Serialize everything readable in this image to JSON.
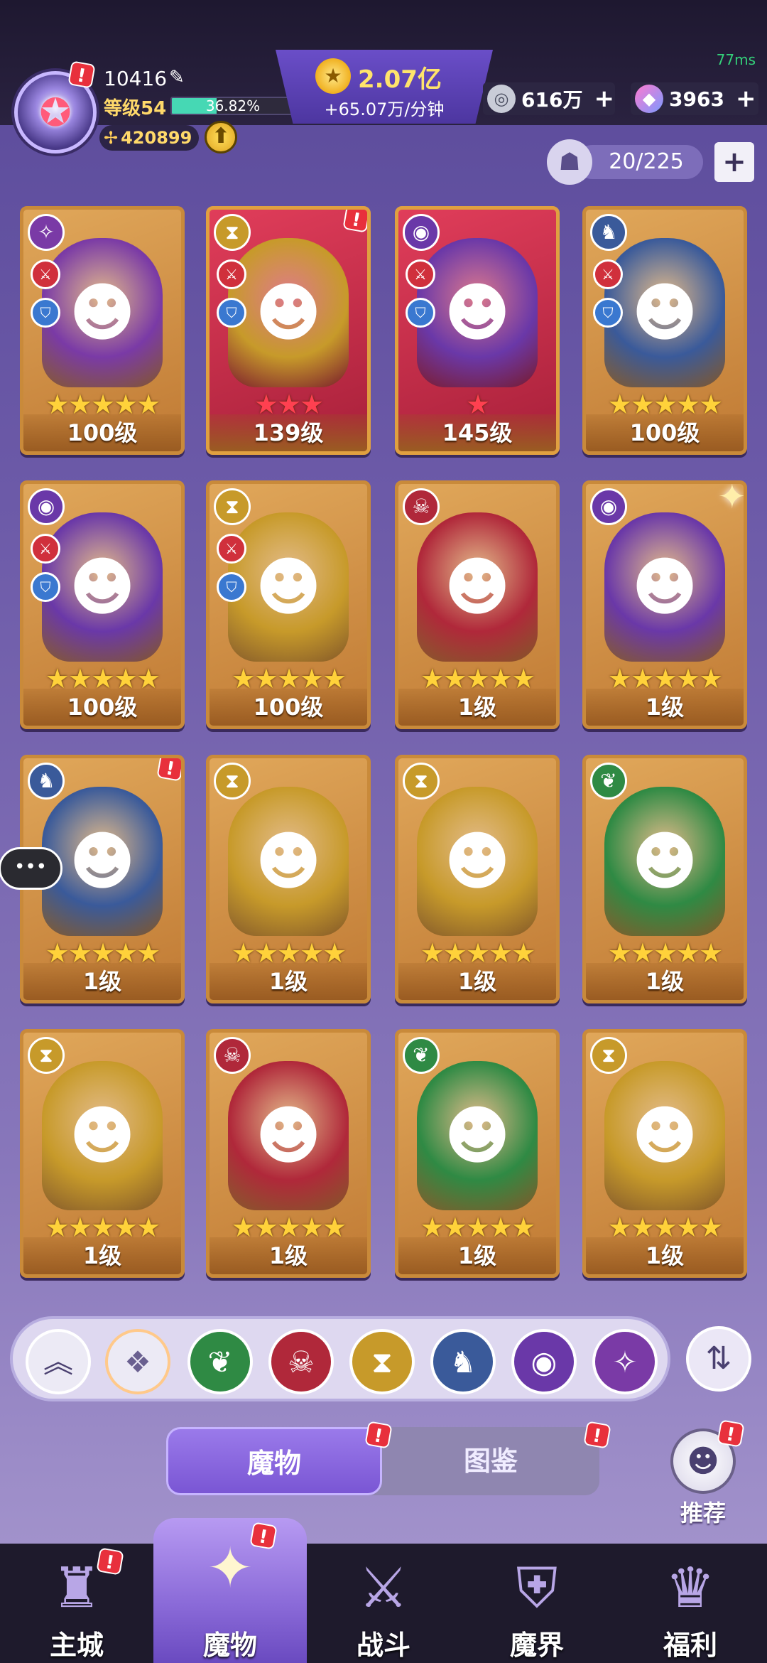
{
  "status": {
    "ping": "77ms"
  },
  "player": {
    "id": "10416",
    "level_label": "等级54",
    "exp_percent_text": "36.82%",
    "exp_fraction": 0.3682,
    "power": "420899"
  },
  "gold": {
    "amount": "2.07亿",
    "rate": "+65.07万/分钟"
  },
  "resources": {
    "silver": "616万",
    "gem": "3963"
  },
  "monster_count": "20/225",
  "monsters": [
    {
      "faction": "arcane",
      "level": "100级",
      "stars": 5,
      "star_color": "gold",
      "badges": true,
      "bg": "normal",
      "icon": "spider-icon"
    },
    {
      "faction": "hourglass",
      "level": "139级",
      "stars": 3,
      "star_color": "red",
      "badges": true,
      "bg": "red",
      "alert": true,
      "icon": "shark-girl-icon"
    },
    {
      "faction": "eye",
      "level": "145级",
      "stars": 1,
      "star_color": "red",
      "badges": true,
      "bg": "red",
      "icon": "pink-demon-girl-icon"
    },
    {
      "faction": "dragon",
      "level": "100级",
      "stars": 5,
      "star_color": "gold",
      "badges": true,
      "bg": "normal",
      "icon": "elf-warrior-icon"
    },
    {
      "faction": "eye",
      "level": "100级",
      "stars": 5,
      "star_color": "gold",
      "badges": true,
      "bg": "normal",
      "icon": "witch-icon"
    },
    {
      "faction": "hourglass",
      "level": "100级",
      "stars": 5,
      "star_color": "gold",
      "badges": true,
      "bg": "normal",
      "icon": "bunny-girl-icon"
    },
    {
      "faction": "mask",
      "level": "1级",
      "stars": 5,
      "star_color": "gold",
      "badges": false,
      "bg": "normal",
      "icon": "werewolf-icon"
    },
    {
      "faction": "eye",
      "level": "1级",
      "stars": 5,
      "star_color": "gold",
      "badges": false,
      "bg": "normal",
      "sparkle": true,
      "icon": "vampire-icon"
    },
    {
      "faction": "dragon",
      "level": "1级",
      "stars": 5,
      "star_color": "gold",
      "badges": false,
      "bg": "normal",
      "chat": true,
      "alert": true,
      "icon": "lizard-shaman-icon"
    },
    {
      "faction": "hourglass",
      "level": "1级",
      "stars": 5,
      "star_color": "gold",
      "badges": false,
      "bg": "normal",
      "icon": "ghost-icon"
    },
    {
      "faction": "hourglass",
      "level": "1级",
      "stars": 5,
      "star_color": "gold",
      "badges": false,
      "bg": "normal",
      "icon": "armored-knight-icon"
    },
    {
      "faction": "leaf",
      "level": "1级",
      "stars": 5,
      "star_color": "gold",
      "badges": false,
      "bg": "normal",
      "icon": "plant-queen-icon"
    },
    {
      "faction": "hourglass",
      "level": "1级",
      "stars": 5,
      "star_color": "gold",
      "badges": false,
      "bg": "normal",
      "icon": "shark-girl-icon"
    },
    {
      "faction": "mask",
      "level": "1级",
      "stars": 5,
      "star_color": "gold",
      "badges": false,
      "bg": "normal",
      "icon": "masked-lady-icon"
    },
    {
      "faction": "leaf",
      "level": "1级",
      "stars": 5,
      "star_color": "gold",
      "badges": false,
      "bg": "normal",
      "icon": "plant-queen-icon"
    },
    {
      "faction": "hourglass",
      "level": "1级",
      "stars": 5,
      "star_color": "gold",
      "badges": false,
      "bg": "normal",
      "icon": "rose-lady-icon"
    }
  ],
  "filters": [
    {
      "name": "collapse",
      "icon": "chevron-up-icon",
      "glyph": "︽",
      "color": "#eceaf5",
      "fg": "#4a4070"
    },
    {
      "name": "all",
      "icon": "diamond-grid-icon",
      "glyph": "❖",
      "color": "#eceaf5",
      "fg": "#6a6090",
      "selected": true
    },
    {
      "name": "leaf",
      "icon": "leaf-icon",
      "glyph": "❦",
      "color": "#2f8a44"
    },
    {
      "name": "mask",
      "icon": "mask-icon",
      "glyph": "☠",
      "color": "#b0283a"
    },
    {
      "name": "hourglass",
      "icon": "hourglass-icon",
      "glyph": "⧗",
      "color": "#c79a2a"
    },
    {
      "name": "dragon",
      "icon": "dragon-icon",
      "glyph": "♞",
      "color": "#3a5a9a"
    },
    {
      "name": "eye",
      "icon": "eye-icon",
      "glyph": "◉",
      "color": "#6a38a8"
    },
    {
      "name": "arcane",
      "icon": "arcane-icon",
      "glyph": "✧",
      "color": "#7a3aa6"
    }
  ],
  "tabs": {
    "monster": "魔物",
    "codex": "图鉴"
  },
  "recommend": "推荐",
  "nav": [
    {
      "label": "主城",
      "icon": "castle-icon",
      "glyph": "♜",
      "alert": true
    },
    {
      "label": "魔物",
      "icon": "monster-flame-icon",
      "glyph": "✦",
      "alert": true,
      "active": true
    },
    {
      "label": "战斗",
      "icon": "sword-shield-icon",
      "glyph": "⚔"
    },
    {
      "label": "魔界",
      "icon": "demon-realm-icon",
      "glyph": "⛨"
    },
    {
      "label": "福利",
      "icon": "treasure-chest-icon",
      "glyph": "♛"
    }
  ],
  "faction_colors": {
    "arcane": "#7a3aa6",
    "hourglass": "#c79a2a",
    "eye": "#6a38a8",
    "dragon": "#3a5a9a",
    "mask": "#b0283a",
    "leaf": "#2f8a44"
  },
  "faction_glyphs": {
    "arcane": "✧",
    "hourglass": "⧗",
    "eye": "◉",
    "dragon": "♞",
    "mask": "☠",
    "leaf": "❦"
  }
}
